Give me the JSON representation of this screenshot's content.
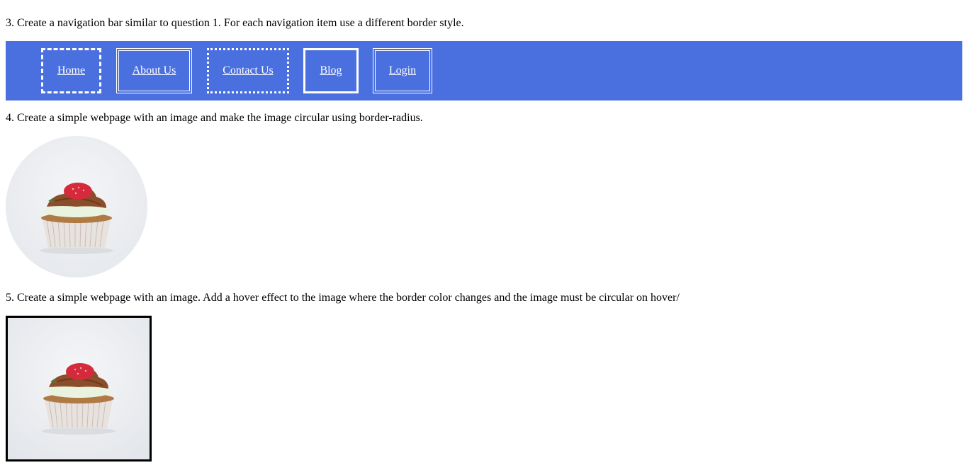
{
  "questions": {
    "q3": "3. Create a navigation bar similar to question 1. For each navigation item use a different border style.",
    "q4": "4. Create a simple webpage with an image and make the image circular using border-radius.",
    "q5": "5. Create a simple webpage with an image. Add a hover effect to the image where the border color changes and the image must be circular on hover/"
  },
  "nav": {
    "background": "#4a6fdf",
    "items": [
      {
        "label": "Home",
        "border_style": "dashed"
      },
      {
        "label": "About Us",
        "border_style": "double"
      },
      {
        "label": "Contact Us",
        "border_style": "dotted"
      },
      {
        "label": "Blog",
        "border_style": "solid"
      },
      {
        "label": "Login",
        "border_style": "double"
      }
    ]
  },
  "images": {
    "circular": {
      "subject": "cupcake-photo",
      "shape": "circle"
    },
    "bordered": {
      "subject": "cupcake-photo",
      "shape": "square",
      "border_color": "#000000"
    }
  }
}
